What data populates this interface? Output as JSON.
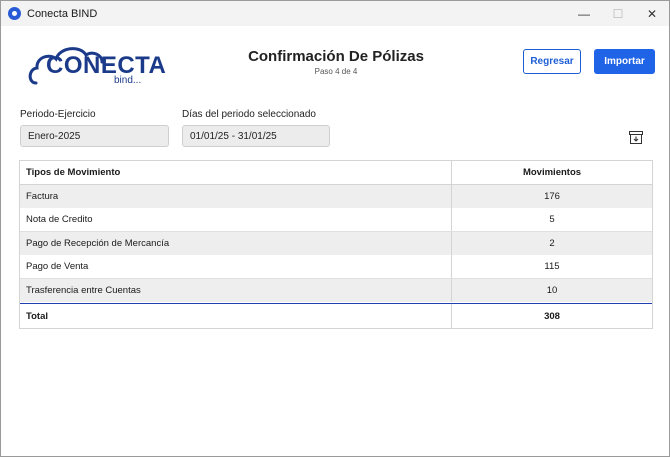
{
  "window": {
    "title": "Conecta BIND",
    "controls": {
      "minimize": "—",
      "maximize": "☐",
      "close": "✕"
    }
  },
  "logo": {
    "main": "CONECTA",
    "sub": "bind..."
  },
  "header": {
    "title": "Confirmación De Pólizas",
    "step": "Paso 4 de 4",
    "back_label": "Regresar",
    "import_label": "Importar"
  },
  "filters": {
    "period_label": "Periodo-Ejercicio",
    "period_value": "Enero-2025",
    "days_label": "Días del periodo seleccionado",
    "days_value": "01/01/25 - 31/01/25"
  },
  "table": {
    "headers": {
      "type": "Tipos de Movimiento",
      "count": "Movimientos"
    },
    "rows": [
      {
        "type": "Factura",
        "count": "176"
      },
      {
        "type": "Nota de Credito",
        "count": "5"
      },
      {
        "type": "Pago de Recepción de Mercancía",
        "count": "2"
      },
      {
        "type": "Pago de Venta",
        "count": "115"
      },
      {
        "type": "Trasferencia entre Cuentas",
        "count": "10"
      }
    ],
    "total": {
      "label": "Total",
      "count": "308"
    }
  },
  "colors": {
    "accent": "#1f63e6",
    "logo": "#1b3a8a",
    "row_shade": "#eeeeee",
    "total_rule": "#2040b0"
  },
  "icons": {
    "app": "app-icon",
    "export": "export-icon"
  }
}
